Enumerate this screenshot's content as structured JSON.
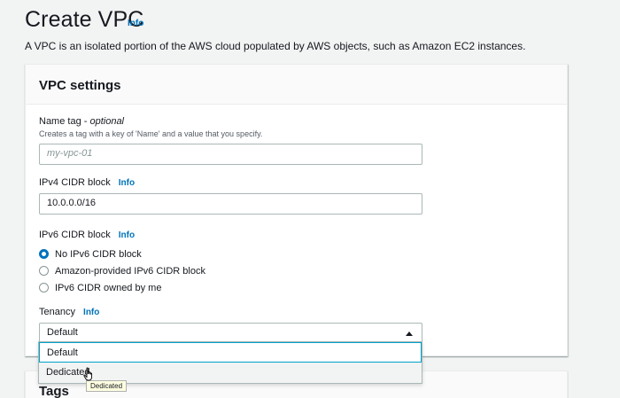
{
  "page": {
    "title": "Create VPC",
    "info_label": "Info",
    "description": "A VPC is an isolated portion of the AWS cloud populated by AWS objects, such as Amazon EC2 instances."
  },
  "vpc_settings": {
    "title": "VPC settings",
    "name_tag": {
      "label": "Name tag - ",
      "label_optional": "optional",
      "hint": "Creates a tag with a key of 'Name' and a value that you specify.",
      "placeholder": "my-vpc-01",
      "value": ""
    },
    "ipv4": {
      "label": "IPv4 CIDR block",
      "info_label": "Info",
      "value": "10.0.0.0/16"
    },
    "ipv6": {
      "label": "IPv6 CIDR block",
      "info_label": "Info",
      "options": [
        {
          "label": "No IPv6 CIDR block",
          "checked": true
        },
        {
          "label": "Amazon-provided IPv6 CIDR block",
          "checked": false
        },
        {
          "label": "IPv6 CIDR owned by me",
          "checked": false
        }
      ]
    },
    "tenancy": {
      "label": "Tenancy",
      "info_label": "Info",
      "selected": "Default",
      "options": [
        "Default",
        "Dedicated"
      ],
      "tooltip": "Dedicated"
    }
  },
  "tags": {
    "title": "Tags"
  },
  "colors": {
    "link": "#0073bb",
    "radio_checked": "#0073bb",
    "focus_ring": "#00a1c9"
  }
}
